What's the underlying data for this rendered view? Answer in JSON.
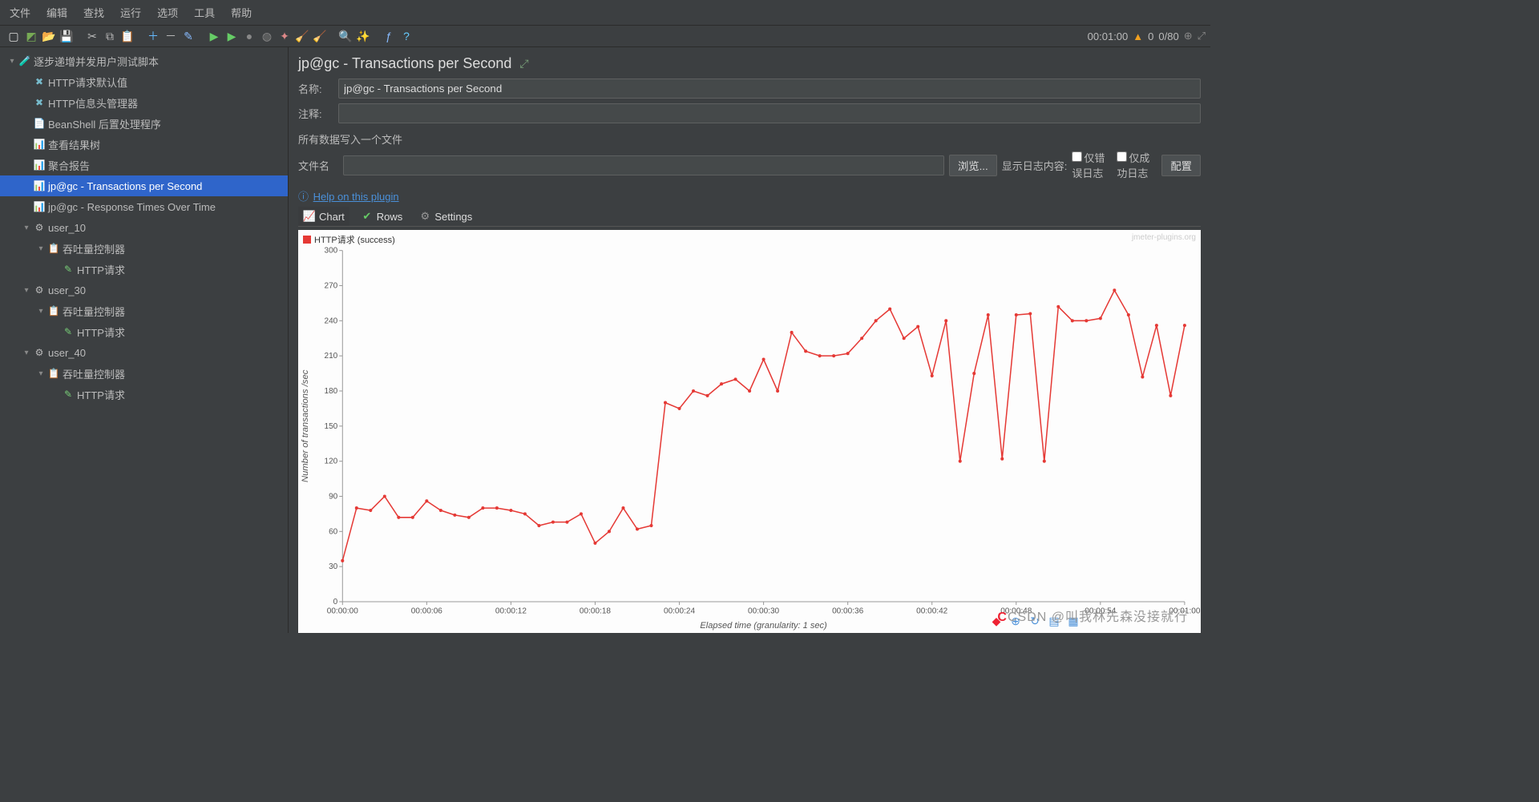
{
  "menubar": [
    "文件",
    "编辑",
    "查找",
    "运行",
    "选项",
    "工具",
    "帮助"
  ],
  "toolbar_right": {
    "time": "00:01:00",
    "warn": "0",
    "threads": "0/80"
  },
  "tree": [
    {
      "indent": 0,
      "tw": "▾",
      "icon": "🧪",
      "color": "#9bd",
      "label": "逐步递增并发用户测试脚本"
    },
    {
      "indent": 1,
      "tw": "",
      "icon": "✖",
      "color": "#7bc",
      "label": "HTTP请求默认值"
    },
    {
      "indent": 1,
      "tw": "",
      "icon": "✖",
      "color": "#7bc",
      "label": "HTTP信息头管理器"
    },
    {
      "indent": 1,
      "tw": "",
      "icon": "📄",
      "color": "#ddd",
      "label": "BeanShell 后置处理程序"
    },
    {
      "indent": 1,
      "tw": "",
      "icon": "📊",
      "color": "#d66",
      "label": "查看结果树"
    },
    {
      "indent": 1,
      "tw": "",
      "icon": "📊",
      "color": "#d66",
      "label": "聚合报告"
    },
    {
      "indent": 1,
      "tw": "",
      "icon": "📊",
      "color": "#d66",
      "label": "jp@gc - Transactions per Second",
      "selected": true
    },
    {
      "indent": 1,
      "tw": "",
      "icon": "📊",
      "color": "#d66",
      "label": "jp@gc - Response Times Over Time"
    },
    {
      "indent": 1,
      "tw": "▾",
      "icon": "⚙",
      "color": "#bbb",
      "label": "user_10"
    },
    {
      "indent": 2,
      "tw": "▾",
      "icon": "📋",
      "color": "#8ad",
      "label": "吞吐量控制器"
    },
    {
      "indent": 3,
      "tw": "",
      "icon": "✎",
      "color": "#7c7",
      "label": "HTTP请求"
    },
    {
      "indent": 1,
      "tw": "▾",
      "icon": "⚙",
      "color": "#bbb",
      "label": "user_30"
    },
    {
      "indent": 2,
      "tw": "▾",
      "icon": "📋",
      "color": "#8ad",
      "label": "吞吐量控制器"
    },
    {
      "indent": 3,
      "tw": "",
      "icon": "✎",
      "color": "#7c7",
      "label": "HTTP请求"
    },
    {
      "indent": 1,
      "tw": "▾",
      "icon": "⚙",
      "color": "#bbb",
      "label": "user_40"
    },
    {
      "indent": 2,
      "tw": "▾",
      "icon": "📋",
      "color": "#8ad",
      "label": "吞吐量控制器"
    },
    {
      "indent": 3,
      "tw": "",
      "icon": "✎",
      "color": "#7c7",
      "label": "HTTP请求"
    }
  ],
  "panel": {
    "title": "jp@gc - Transactions per Second",
    "name_label": "名称:",
    "name_value": "jp@gc - Transactions per Second",
    "comment_label": "注释:",
    "comment_value": "",
    "section": "所有数据写入一个文件",
    "file_label": "文件名",
    "file_value": "",
    "browse": "浏览...",
    "show_log": "显示日志内容:",
    "only_err": "仅错误日志",
    "only_ok": "仅成功日志",
    "config": "配置",
    "help": "Help on this plugin",
    "tabs": {
      "chart": "Chart",
      "rows": "Rows",
      "settings": "Settings"
    },
    "legend": "HTTP请求 (success)",
    "watermark": "jmeter-plugins.org",
    "csdn": "CSDN @叫我林先森没接就行"
  },
  "chart_data": {
    "type": "line",
    "title": "",
    "xlabel": "Elapsed time (granularity: 1 sec)",
    "ylabel": "Number of transactions /sec",
    "ylim": [
      0,
      300
    ],
    "yticks": [
      0,
      30,
      60,
      90,
      120,
      150,
      180,
      210,
      240,
      270,
      300
    ],
    "xticks": [
      "00:00:00",
      "00:00:06",
      "00:00:12",
      "00:00:18",
      "00:00:24",
      "00:00:30",
      "00:00:36",
      "00:00:42",
      "00:00:48",
      "00:00:54",
      "00:01:00"
    ],
    "series": [
      {
        "name": "HTTP请求 (success)",
        "color": "#e53935",
        "x": [
          0,
          1,
          2,
          3,
          4,
          5,
          6,
          7,
          8,
          9,
          10,
          11,
          12,
          13,
          14,
          15,
          16,
          17,
          18,
          19,
          20,
          21,
          22,
          23,
          24,
          25,
          26,
          27,
          28,
          29,
          30,
          31,
          32,
          33,
          34,
          35,
          36,
          37,
          38,
          39,
          40,
          41,
          42,
          43,
          44,
          45,
          46,
          47,
          48,
          49,
          50,
          51,
          52,
          53,
          54,
          55,
          56,
          57,
          58,
          59,
          60
        ],
        "values": [
          35,
          80,
          78,
          90,
          72,
          72,
          86,
          78,
          74,
          72,
          80,
          80,
          78,
          75,
          65,
          68,
          68,
          75,
          50,
          60,
          80,
          62,
          65,
          170,
          165,
          180,
          176,
          186,
          190,
          180,
          207,
          180,
          230,
          214,
          210,
          210,
          212,
          225,
          240,
          250,
          225,
          235,
          193,
          240,
          120,
          195,
          245,
          122,
          245,
          246,
          120,
          252,
          240,
          240,
          242,
          266,
          245,
          192,
          236,
          176,
          236
        ]
      }
    ]
  }
}
